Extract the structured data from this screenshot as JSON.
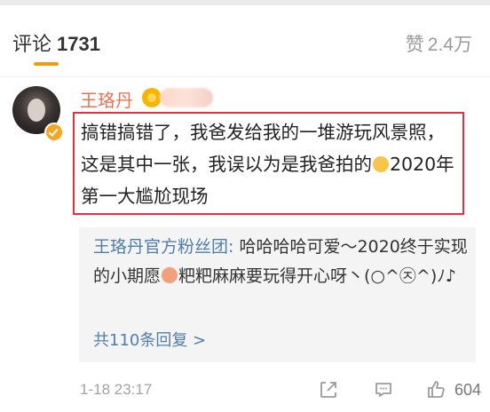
{
  "header": {
    "comments_label": "评论",
    "comments_count": "1731",
    "likes_label": "赞",
    "likes_count": "2.4万"
  },
  "comment": {
    "author": "王珞丹",
    "text_part1": "搞错搞错了，我爸发给我的一堆游玩风景照，这是其中一张，我误以为是我爸拍的",
    "emoji": "laughing-tears-emoji",
    "text_part2": "2020年第一大尴尬现场",
    "time": "1-18 23:17",
    "like_count": "604"
  },
  "reply": {
    "author": "王珞丹官方粉丝团:",
    "text_part1": " 哈哈哈哈可爱～2020终于实现的小期愿",
    "emoji": "pig-emoji",
    "text_part2": "粑粑麻麻要玩得开心呀丶(○^㉨^)ﾉ♪",
    "more_link": "共110条回复 >"
  },
  "colors": {
    "author": "#eb7350",
    "link": "#507daf",
    "highlight": "#e4323c",
    "accent": "#f39a15"
  }
}
